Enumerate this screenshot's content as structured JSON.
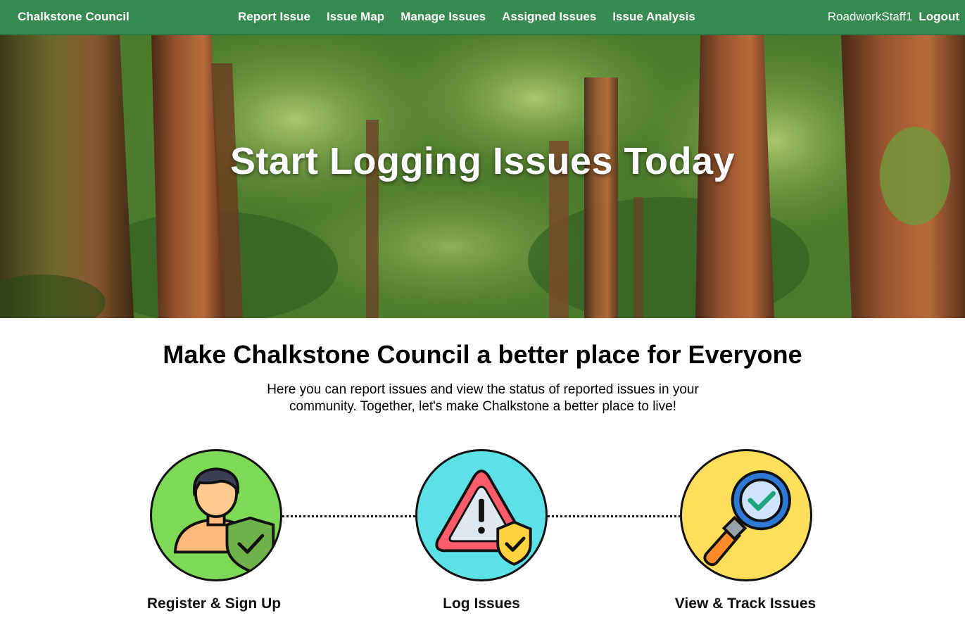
{
  "nav": {
    "brand": "Chalkstone Council",
    "links": [
      "Report Issue",
      "Issue Map",
      "Manage Issues",
      "Assigned Issues",
      "Issue Analysis"
    ],
    "username": "RoadworkStaff1",
    "logout": "Logout",
    "color": "#368a4f"
  },
  "hero": {
    "title": "Start Logging Issues Today"
  },
  "intro": {
    "headline": "Make Chalkstone Council a better place for Everyone",
    "text": "Here you can report issues and view the status of reported issues in your community. Together, let's make Chalkstone a better place to live!"
  },
  "steps": [
    {
      "label": "Register & Sign Up",
      "icon": "user-shield-icon",
      "color": "#7ed957"
    },
    {
      "label": "Log Issues",
      "icon": "warning-shield-icon",
      "color": "#5ce1e6"
    },
    {
      "label": "View & Track Issues",
      "icon": "magnifier-check-icon",
      "color": "#ffde59"
    }
  ]
}
